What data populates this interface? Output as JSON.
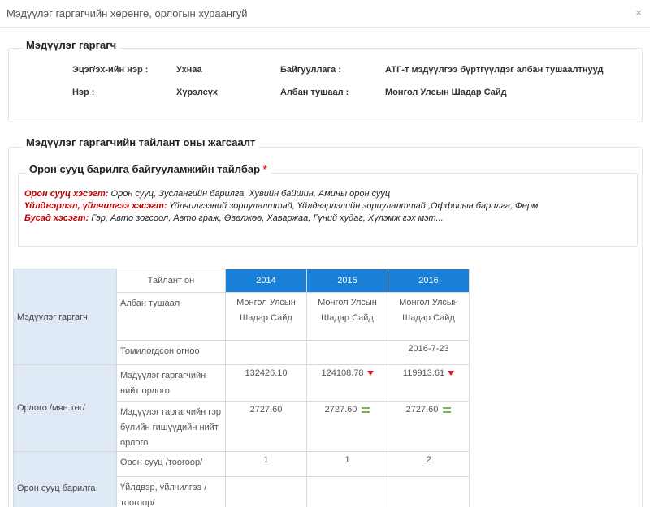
{
  "modal": {
    "title": "Мэдүүлэг гаргагчийн хөрөнгө, орлогын хураангуй",
    "close_glyph": "×"
  },
  "declarant": {
    "legend": "Мэдүүлэг гаргагч",
    "surname_label": "Эцэг/эх-ийн нэр :",
    "surname": "Ухнаа",
    "org_label": "Байгууллага :",
    "org": "АТГ-т мэдүүлгээ бүртгүүлдэг албан тушаалтнууд",
    "name_label": "Нэр :",
    "name": "Хүрэлсүх",
    "position_label": "Албан тушаал :",
    "position": "Монгол Улсын Шадар Сайд"
  },
  "report_list": {
    "legend": "Мэдүүлэг гаргагчийн тайлант оны жагсаалт"
  },
  "description": {
    "legend": "Орон сууц барилга байгууламжийн тайлбар",
    "required_mark": "*",
    "lines": [
      {
        "label": "Орон сууц хэсэгт:",
        "text": " Орон сууц, Зуслангийн барилга, Хувийн байшин, Амины орон сууц"
      },
      {
        "label": "Үйлдвэрлэл, үйлчилгээ хэсэгт:",
        "text": " Үйлчилгээний зориулалттай, Үйлдвэрлэлийн зориулалттай ,Оффисын барилга, Ферм"
      },
      {
        "label": "Бусад хэсэгт:",
        "text": " Гэр, Авто зогсоол, Авто граж, Өвөлжөө, Хаваржаа, Гүний худаг, Хүлэмж гэх мэт..."
      }
    ]
  },
  "table": {
    "year_header": "Тайлант он",
    "years": [
      "2014",
      "2015",
      "2016"
    ],
    "groups": {
      "declarant": "Мэдүүлэг гаргагч",
      "income": "Орлого /мян.төг/",
      "housing": "Орон сууц барилга"
    },
    "rows": {
      "position": {
        "label": "Албан тушаал",
        "values": [
          "Монгол Улсын Шадар Сайд",
          "Монгол Улсын Шадар Сайд",
          "Монгол Улсын Шадар Сайд"
        ]
      },
      "appointed": {
        "label": "Томилогдсон огноо",
        "values": [
          "",
          "",
          "2016-7-23"
        ]
      },
      "total_income": {
        "label": "Мэдүүлэг гаргагчийн нийт орлого",
        "values": [
          "132426.10",
          "124108.78",
          "119913.61"
        ]
      },
      "family_income": {
        "label": "Мэдүүлэг гаргагчийн гэр бүлийн гишүүдийн нийт орлого",
        "values": [
          "2727.60",
          "2727.60",
          "2727.60"
        ]
      },
      "housing_count": {
        "label": "Орон сууц /тоогоор/",
        "values": [
          "1",
          "1",
          "2"
        ]
      },
      "industrial_count": {
        "label": "Үйлдвэр, үйлчилгээ /тоогоор/",
        "values": [
          "",
          "",
          ""
        ]
      }
    },
    "icons": {
      "decrease": "arrow-down-icon",
      "unchanged": "equal-icon",
      "decrease_color": "#d62020",
      "unchanged_color": "#7bb84a",
      "header_color": "#1a7fd6",
      "group_color": "#dfeaf6"
    }
  }
}
